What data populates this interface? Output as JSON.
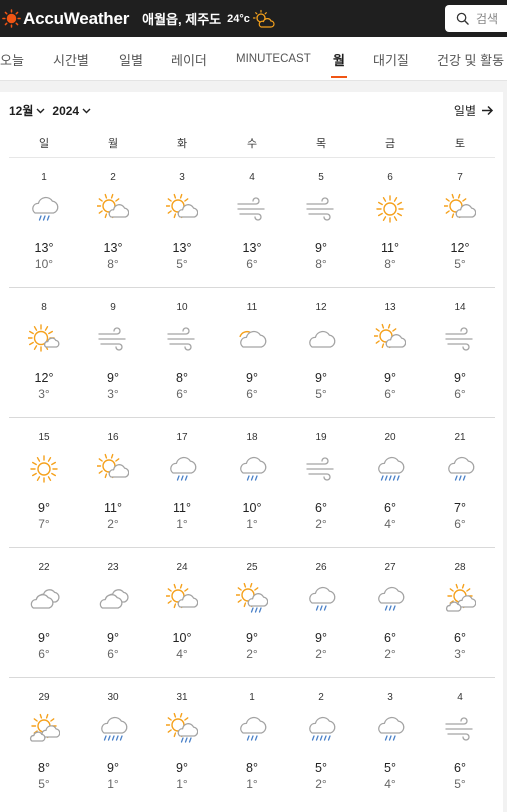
{
  "header": {
    "brand": "AccuWeather",
    "location": "애월읍, 제주도",
    "temperature": "24°c",
    "search_placeholder": "검색"
  },
  "nav_tabs": [
    {
      "label": "오늘"
    },
    {
      "label": "시간별"
    },
    {
      "label": "일별"
    },
    {
      "label": "레이더"
    },
    {
      "label": "MINUTECAST"
    },
    {
      "label": "월",
      "active": true
    },
    {
      "label": "대기질"
    },
    {
      "label": "건강 및 활동"
    }
  ],
  "calendar": {
    "month_label": "12월",
    "year_label": "2024",
    "daily_link": "일별",
    "weekdays": [
      "일",
      "월",
      "화",
      "수",
      "목",
      "금",
      "토"
    ],
    "days": [
      {
        "date": "1",
        "icon": "rain-cloud",
        "hi": "13°",
        "lo": "10°"
      },
      {
        "date": "2",
        "icon": "sun-cloud",
        "hi": "13°",
        "lo": "8°"
      },
      {
        "date": "3",
        "icon": "sun-cloud",
        "hi": "13°",
        "lo": "5°"
      },
      {
        "date": "4",
        "icon": "wind",
        "hi": "13°",
        "lo": "6°"
      },
      {
        "date": "5",
        "icon": "wind",
        "hi": "9°",
        "lo": "8°"
      },
      {
        "date": "6",
        "icon": "sun",
        "hi": "11°",
        "lo": "8°"
      },
      {
        "date": "7",
        "icon": "sun-cloud",
        "hi": "12°",
        "lo": "5°"
      },
      {
        "date": "8",
        "icon": "sun-small-cloud",
        "hi": "12°",
        "lo": "3°"
      },
      {
        "date": "9",
        "icon": "wind",
        "hi": "9°",
        "lo": "3°"
      },
      {
        "date": "10",
        "icon": "wind",
        "hi": "8°",
        "lo": "6°"
      },
      {
        "date": "11",
        "icon": "cloud-sun-behind",
        "hi": "9°",
        "lo": "6°"
      },
      {
        "date": "12",
        "icon": "cloud",
        "hi": "9°",
        "lo": "5°"
      },
      {
        "date": "13",
        "icon": "sun-cloud",
        "hi": "9°",
        "lo": "6°"
      },
      {
        "date": "14",
        "icon": "wind",
        "hi": "9°",
        "lo": "6°"
      },
      {
        "date": "15",
        "icon": "sun",
        "hi": "9°",
        "lo": "7°"
      },
      {
        "date": "16",
        "icon": "sun-cloud",
        "hi": "11°",
        "lo": "2°"
      },
      {
        "date": "17",
        "icon": "rain-cloud",
        "hi": "11°",
        "lo": "1°"
      },
      {
        "date": "18",
        "icon": "rain-cloud",
        "hi": "10°",
        "lo": "1°"
      },
      {
        "date": "19",
        "icon": "wind",
        "hi": "6°",
        "lo": "2°"
      },
      {
        "date": "20",
        "icon": "rain-cloud-heavy",
        "hi": "6°",
        "lo": "4°"
      },
      {
        "date": "21",
        "icon": "rain-cloud",
        "hi": "7°",
        "lo": "6°"
      },
      {
        "date": "22",
        "icon": "cloud-double",
        "hi": "9°",
        "lo": "6°"
      },
      {
        "date": "23",
        "icon": "cloud-double",
        "hi": "9°",
        "lo": "6°"
      },
      {
        "date": "24",
        "icon": "sun-cloud",
        "hi": "10°",
        "lo": "4°"
      },
      {
        "date": "25",
        "icon": "sun-rain",
        "hi": "9°",
        "lo": "2°"
      },
      {
        "date": "26",
        "icon": "rain-cloud",
        "hi": "9°",
        "lo": "2°"
      },
      {
        "date": "27",
        "icon": "rain-cloud",
        "hi": "6°",
        "lo": "2°"
      },
      {
        "date": "28",
        "icon": "sun-cloud-double",
        "hi": "6°",
        "lo": "3°"
      },
      {
        "date": "29",
        "icon": "sun-cloud-double",
        "hi": "8°",
        "lo": "5°"
      },
      {
        "date": "30",
        "icon": "rain-cloud-heavy",
        "hi": "9°",
        "lo": "1°"
      },
      {
        "date": "31",
        "icon": "sun-rain",
        "hi": "9°",
        "lo": "1°"
      },
      {
        "date": "1",
        "icon": "rain-cloud",
        "hi": "8°",
        "lo": "1°"
      },
      {
        "date": "2",
        "icon": "rain-cloud-heavy",
        "hi": "5°",
        "lo": "2°"
      },
      {
        "date": "3",
        "icon": "rain-cloud",
        "hi": "5°",
        "lo": "4°"
      },
      {
        "date": "4",
        "icon": "wind",
        "hi": "6°",
        "lo": "5°"
      }
    ]
  },
  "colors": {
    "sun": "#f5a11c",
    "cloud": "#a3a3a3",
    "rain": "#4a80c8",
    "accent": "#f05514",
    "header_bg": "#1f1f1f"
  }
}
